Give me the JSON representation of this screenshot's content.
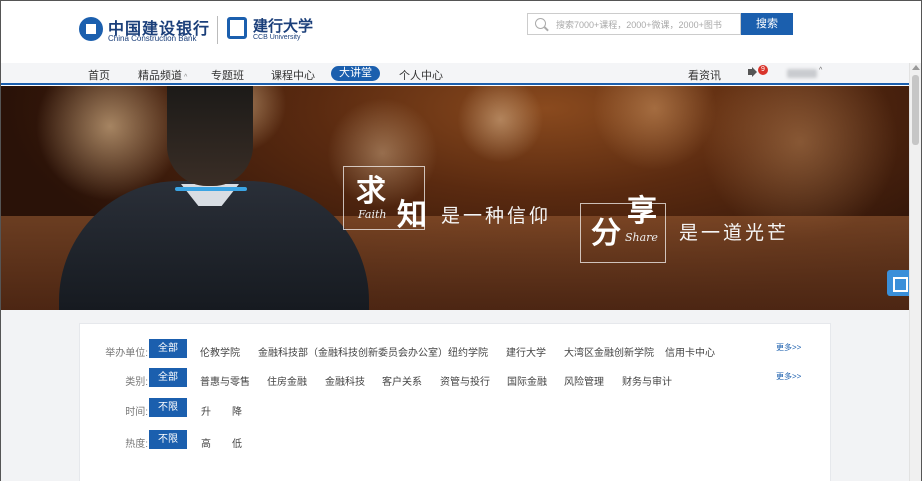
{
  "header": {
    "ccb_name_cn": "中国建设银行",
    "ccb_name_en": "China Construction Bank",
    "uni_name_cn": "建行大学",
    "uni_name_en": "CCB University",
    "search_placeholder": "搜索7000+课程，2000+微课，2000+图书",
    "search_button": "搜索"
  },
  "nav": {
    "items": [
      "首页",
      "精品频道",
      "专题班",
      "课程中心",
      "大讲堂",
      "个人中心"
    ],
    "caret": "^",
    "active": "大讲堂",
    "news": "看资讯",
    "badge_count": "9"
  },
  "banner": {
    "char1": "求",
    "en1": "Faith",
    "char2": "知",
    "line1": "是一种信仰",
    "char3": "分",
    "char4": "享",
    "en2": "Share",
    "line2": "是一道光芒"
  },
  "filters": {
    "rows": [
      {
        "label": "举办单位:",
        "options": [
          "全部",
          "伦教学院",
          "金融科技部（金融科技创新委员会办公室）",
          "纽约学院",
          "建行大学",
          "大湾区金融创新学院",
          "信用卡中心"
        ],
        "more": "更多>>"
      },
      {
        "label": "类别:",
        "options": [
          "全部",
          "普惠与零售",
          "住房金融",
          "金融科技",
          "客户关系",
          "资管与投行",
          "国际金融",
          "风险管理",
          "财务与审计"
        ],
        "more": "更多>>"
      },
      {
        "label": "时间:",
        "options": [
          "不限",
          "升",
          "降"
        ]
      },
      {
        "label": "热度:",
        "options": [
          "不限",
          "高",
          "低"
        ]
      }
    ]
  },
  "colors": {
    "accent": "#1b5fae",
    "badge": "#d9342b",
    "qr_tab": "#3a8fd9"
  }
}
